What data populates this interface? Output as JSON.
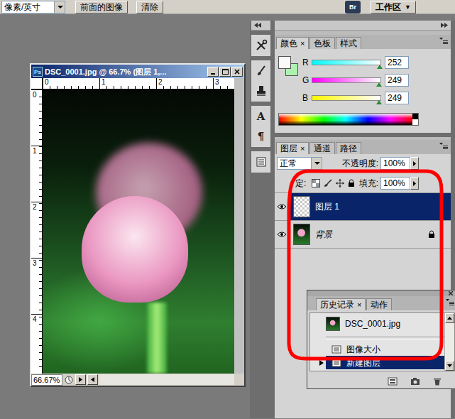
{
  "options_bar": {
    "unit": "像素/英寸",
    "buttons": [
      "前面的图像",
      "清除"
    ],
    "bridge": "Br",
    "workspace": "工作区",
    "workspace_arrow": "▼"
  },
  "document": {
    "app_badge": "Ps",
    "title": "DSC_0001.jpg @ 66.7% (图层 1,...",
    "ruler_top": [
      "0",
      "1",
      "2",
      "3"
    ],
    "ruler_left": [
      "0",
      "1",
      "2",
      "3",
      "4"
    ],
    "zoom": "66.67%"
  },
  "dock": {
    "glyph_tools": [
      "A",
      "¶"
    ]
  },
  "color_panel": {
    "tabs": [
      {
        "label": "颜色",
        "close": "×",
        "selected": true
      },
      {
        "label": "色板",
        "selected": false
      },
      {
        "label": "样式",
        "selected": false
      }
    ],
    "foreground": "#fcf9f9",
    "background": "#aef2b0",
    "channels": [
      {
        "name": "R",
        "value": "252",
        "level": 0.988,
        "color": "#00f9f9"
      },
      {
        "name": "G",
        "value": "249",
        "level": 0.976,
        "color": "#fc00f9"
      },
      {
        "name": "B",
        "value": "249",
        "level": 0.976,
        "color": "#fcf900"
      }
    ]
  },
  "layers_panel": {
    "tabs": [
      {
        "label": "图层",
        "close": "×",
        "selected": true
      },
      {
        "label": "通道",
        "selected": false
      },
      {
        "label": "路径",
        "selected": false
      }
    ],
    "blend_mode": "正常",
    "opacity_label": "不透明度:",
    "opacity": "100%",
    "lock_label": "定:",
    "fill_label": "填充:",
    "fill": "100%",
    "layers": [
      {
        "name": "图层 1",
        "selected": true,
        "visible": true,
        "locked": false,
        "kind": "transparent"
      },
      {
        "name": "背景",
        "selected": false,
        "visible": true,
        "locked": true,
        "kind": "photo"
      }
    ]
  },
  "history_panel": {
    "tabs": [
      {
        "label": "历史记录",
        "close": "×",
        "selected": true
      },
      {
        "label": "动作",
        "selected": false
      }
    ],
    "snapshot": "DSC_0001.jpg",
    "steps": [
      {
        "label": "图像大小",
        "selected": false
      },
      {
        "label": "新建图层",
        "selected": true
      }
    ]
  }
}
